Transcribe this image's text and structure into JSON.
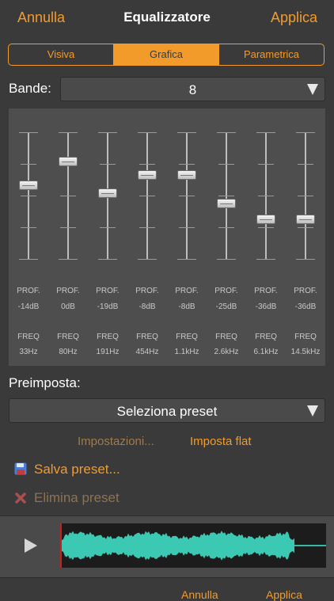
{
  "header": {
    "cancel": "Annulla",
    "title": "Equalizzatore",
    "apply": "Applica"
  },
  "tabs": [
    {
      "label": "Visiva",
      "active": false
    },
    {
      "label": "Grafica",
      "active": true
    },
    {
      "label": "Parametrica",
      "active": false
    }
  ],
  "bands": {
    "label": "Bande:",
    "value": "8"
  },
  "eq": {
    "gain_label": "PROF.",
    "freq_label": "FREQ",
    "sliders": [
      {
        "gain": "-14dB",
        "freq": "33Hz",
        "level": 0.58
      },
      {
        "gain": "0dB",
        "freq": "80Hz",
        "level": 0.77
      },
      {
        "gain": "-19dB",
        "freq": "191Hz",
        "level": 0.52
      },
      {
        "gain": "-8dB",
        "freq": "454Hz",
        "level": 0.66
      },
      {
        "gain": "-8dB",
        "freq": "1.1kHz",
        "level": 0.66
      },
      {
        "gain": "-25dB",
        "freq": "2.6kHz",
        "level": 0.44
      },
      {
        "gain": "-36dB",
        "freq": "6.1kHz",
        "level": 0.31
      },
      {
        "gain": "-36dB",
        "freq": "14.5kHz",
        "level": 0.31
      }
    ]
  },
  "preset": {
    "label": "Preimposta:",
    "select_value": "Seleziona preset",
    "settings_link": "Impostazioni...",
    "flat_link": "Imposta flat",
    "save": "Salva preset...",
    "delete": "Elimina preset"
  },
  "footer": {
    "cancel": "Annulla",
    "apply": "Applica"
  },
  "colors": {
    "accent": "#f29b2b",
    "waveform": "#3cc9b4",
    "background": "#3a3a3a"
  },
  "icons": {
    "save": "floppy-disk-icon",
    "delete": "delete-x-icon",
    "play": "play-icon",
    "dropdown": "triangle-down-icon"
  }
}
